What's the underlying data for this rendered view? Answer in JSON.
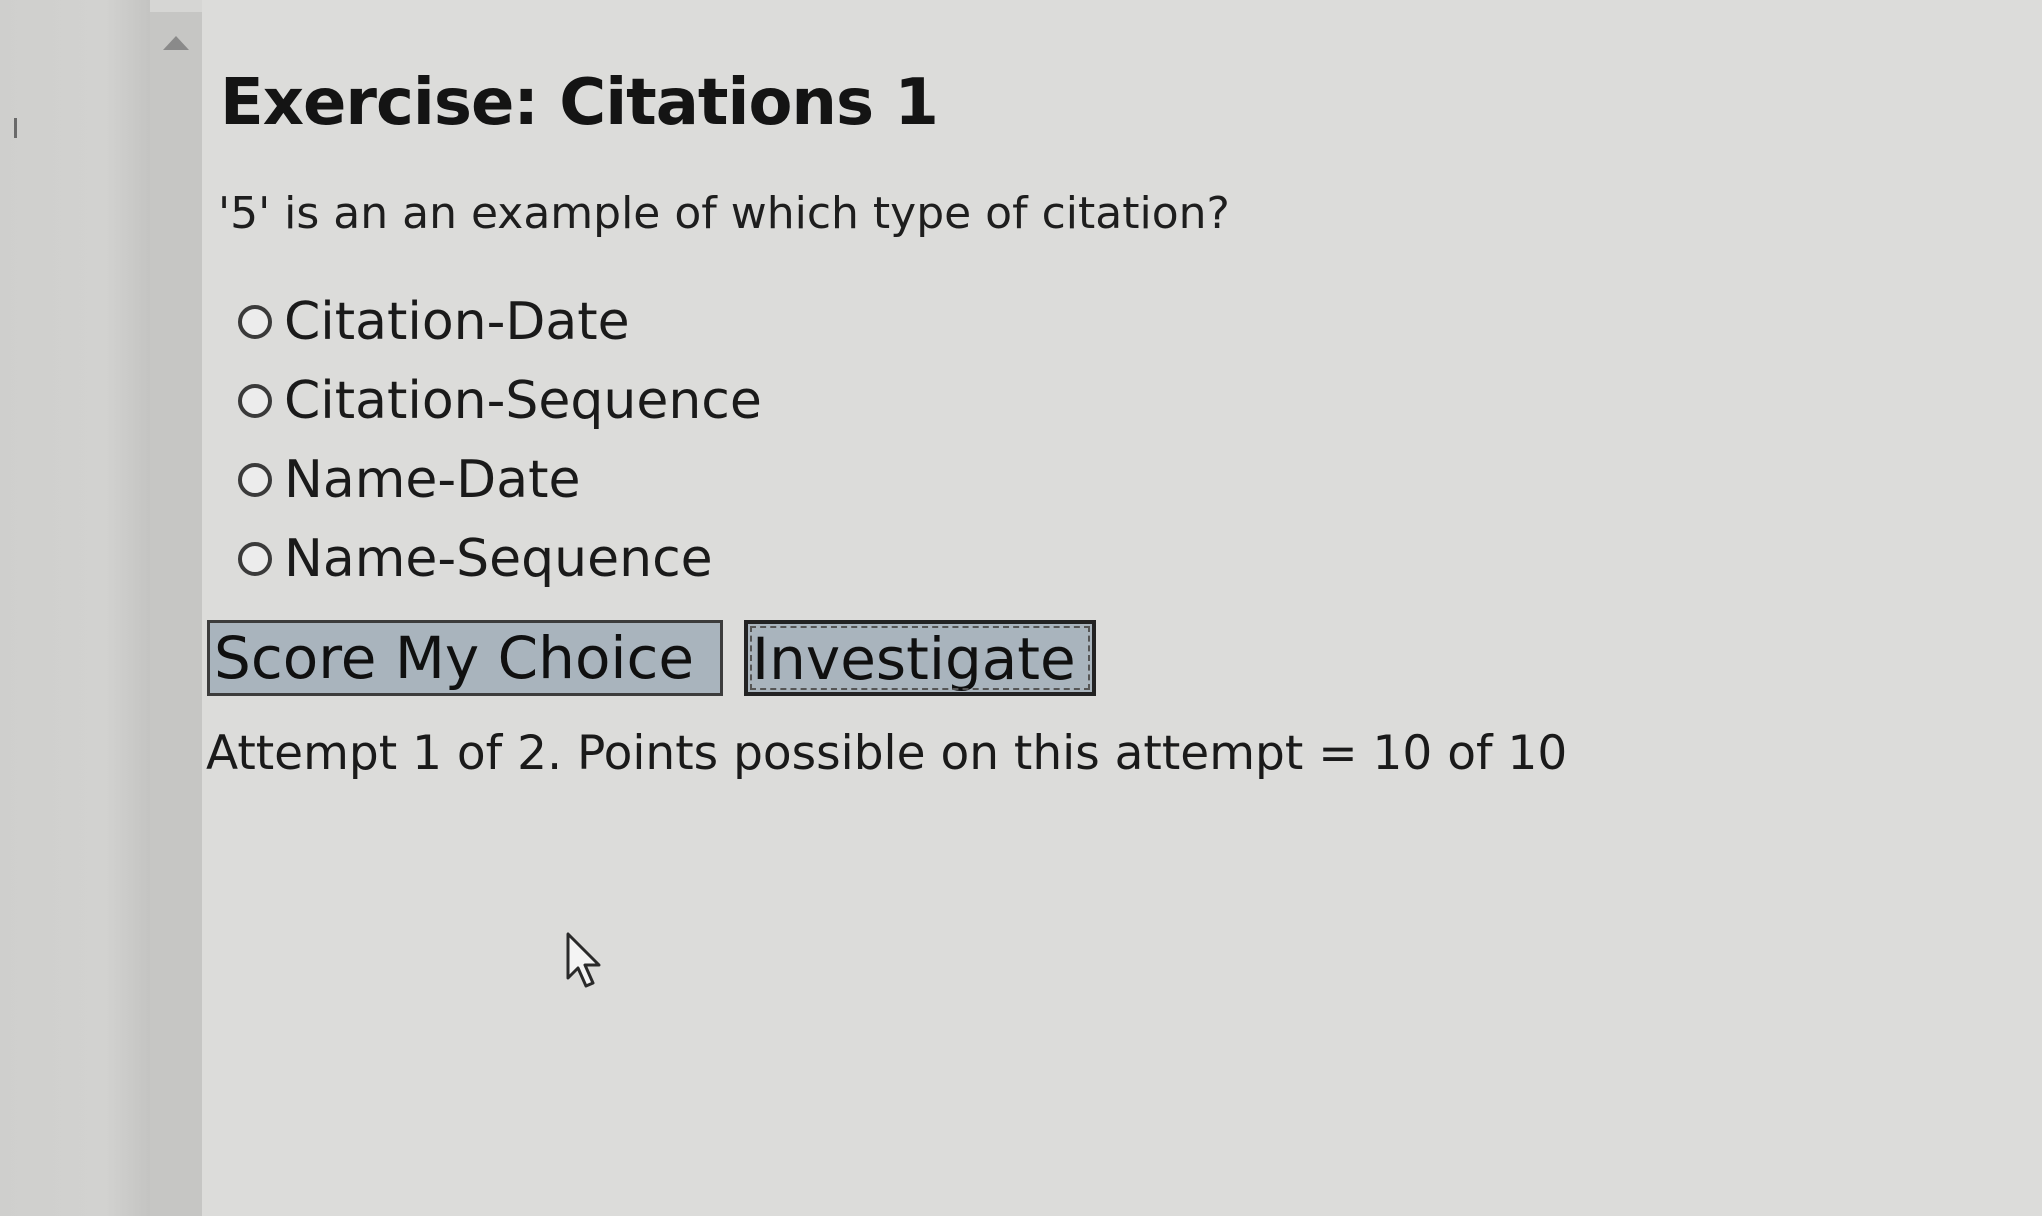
{
  "exercise": {
    "title": "Exercise: Citations 1",
    "question": "'5' is an an example of which type of citation?",
    "options": [
      {
        "label": "Citation-Date",
        "selected": false
      },
      {
        "label": "Citation-Sequence",
        "selected": false
      },
      {
        "label": "Name-Date",
        "selected": false
      },
      {
        "label": "Name-Sequence",
        "selected": false
      }
    ],
    "buttons": {
      "score_label": "Score My Choice",
      "investigate_label": "Investigate"
    },
    "attempt_text": "Attempt 1 of 2. Points possible on this attempt = 10 of 10"
  },
  "icons": {
    "scroll_up": "scroll-up-arrow-icon",
    "cursor": "mouse-pointer-icon"
  },
  "colors": {
    "background": "#dcdcda",
    "button_fill": "#a9b4bd",
    "button_border": "#3c3c3c",
    "text": "#1a1a1a"
  }
}
